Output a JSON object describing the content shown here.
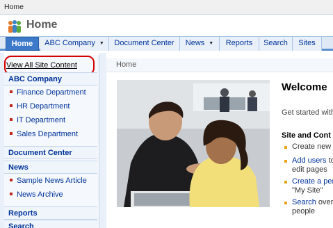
{
  "topbar": {
    "breadcrumb": "Home"
  },
  "header": {
    "site_title": "Home"
  },
  "nav": {
    "tabs": [
      {
        "label": "Home"
      },
      {
        "label": "ABC Company"
      },
      {
        "label": "Document Center"
      },
      {
        "label": "News"
      },
      {
        "label": "Reports"
      },
      {
        "label": "Search"
      },
      {
        "label": "Sites"
      }
    ]
  },
  "quicklaunch": {
    "view_all": "View All Site Content",
    "sections": [
      {
        "heading": "ABC Company",
        "items": [
          "Finance Department",
          "HR Department",
          "IT Department",
          "Sales Department"
        ]
      },
      {
        "heading": "Document Center",
        "items": []
      },
      {
        "heading": "News",
        "items": [
          "Sample News Article",
          "News Archive"
        ]
      },
      {
        "heading": "Reports",
        "items": []
      },
      {
        "heading": "Search",
        "items": []
      }
    ]
  },
  "main": {
    "breadcrumb": "Home",
    "welcome_title": "Welcome",
    "get_started": "Get started with",
    "site_content_heading": "Site and Cont",
    "links": [
      {
        "link": "",
        "text": "Create new"
      },
      {
        "link": "Add users",
        "text": " to"
      },
      {
        "link": "",
        "text": "edit pages"
      },
      {
        "link": "Create a per",
        "text": ""
      },
      {
        "link": "",
        "text": "\"My Site\""
      },
      {
        "link": "Search",
        "text": " over"
      },
      {
        "link": "",
        "text": "people"
      }
    ]
  },
  "colors": {
    "accent": "#3d79c9",
    "link": "#003399",
    "highlight": "#d40000"
  }
}
